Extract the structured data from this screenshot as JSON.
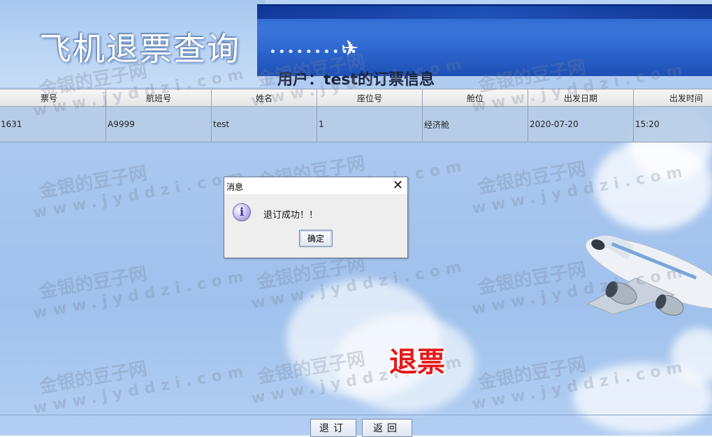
{
  "header": {
    "title": "飞机退票查询",
    "user_heading": "用户：test的订票信息"
  },
  "table": {
    "columns": [
      "票号",
      "航班号",
      "姓名",
      "座位号",
      "舱位",
      "出发日期",
      "出发时间"
    ],
    "rows": [
      [
        "1631",
        "A9999",
        "test",
        "1",
        "经济舱",
        "2020-07-20",
        "15:20"
      ]
    ]
  },
  "dialog": {
    "title": "消息",
    "close_glyph": "✕",
    "icon": "info-icon",
    "message": "退订成功！！",
    "ok_label": "确定"
  },
  "overlay": {
    "refund_label": "退票"
  },
  "buttons": {
    "refund": "退订",
    "back": "返回"
  },
  "watermark": {
    "cn": "金银的豆子网",
    "en": "www.jyddzi.com"
  }
}
